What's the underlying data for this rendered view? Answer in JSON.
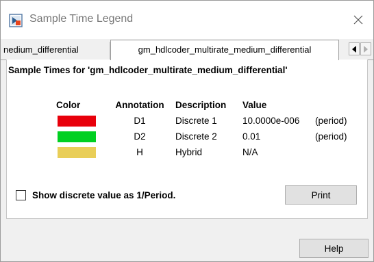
{
  "window": {
    "title": "Sample Time Legend"
  },
  "tabs": [
    {
      "label": "nedium_differential"
    },
    {
      "label": "gm_hdlcoder_multirate_medium_differential"
    }
  ],
  "panel": {
    "heading": "Sample Times for 'gm_hdlcoder_multirate_medium_differential'",
    "columns": [
      "Color",
      "Annotation",
      "Description",
      "Value"
    ],
    "rows": [
      {
        "color": "#e8000b",
        "annotation": "D1",
        "description": "Discrete 1",
        "value": "10.0000e-006",
        "extra": "(period)"
      },
      {
        "color": "#00d021",
        "annotation": "D2",
        "description": "Discrete 2",
        "value": "0.01",
        "extra": "(period)"
      },
      {
        "color": "#e9ce58",
        "annotation": "H",
        "description": "Hybrid",
        "value": "N/A",
        "extra": ""
      }
    ],
    "checkbox_label": "Show discrete value as 1/Period.",
    "checkbox_checked": false,
    "print_label": "Print"
  },
  "footer": {
    "help_label": "Help"
  },
  "icons": {
    "app": "simulink-app-icon",
    "close": "close-icon",
    "scroll_left": "triangle-left-icon",
    "scroll_right": "triangle-right-icon"
  }
}
